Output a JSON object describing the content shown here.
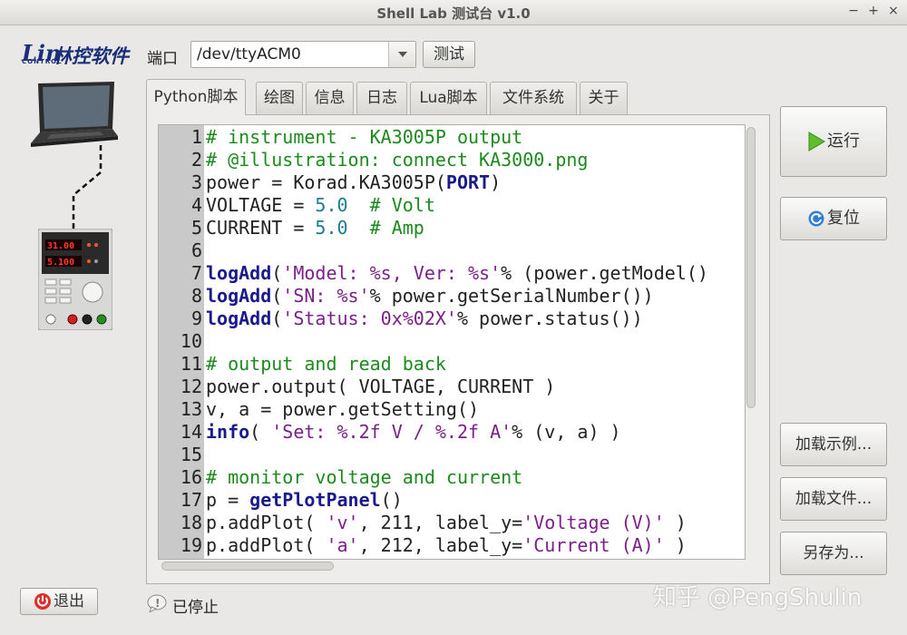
{
  "window": {
    "title": "Shell Lab 测试台 v1.0",
    "controls": [
      "−",
      "+",
      "×"
    ]
  },
  "logo": {
    "mark": "Lin",
    "sub": "CONTROL",
    "brand": "林控软件"
  },
  "port": {
    "label": "端口",
    "value": "/dev/ttyACM0",
    "test_label": "测试"
  },
  "psu_display": {
    "voltage": "31.00",
    "current": "5.100"
  },
  "tabs": [
    {
      "label": "Python脚本",
      "active": true
    },
    {
      "label": "绘图"
    },
    {
      "label": "信息"
    },
    {
      "label": "日志"
    },
    {
      "label": "Lua脚本"
    },
    {
      "label": "文件系统"
    },
    {
      "label": "关于"
    }
  ],
  "editor": {
    "lines": [
      {
        "n": "1",
        "t": [
          [
            "com",
            "# instrument - KA3005P output"
          ]
        ]
      },
      {
        "n": "2",
        "t": [
          [
            "com",
            "# @illustration: connect KA3000.png"
          ]
        ]
      },
      {
        "n": "3",
        "t": [
          [
            "",
            "power = Korad.KA3005P("
          ],
          [
            "kw",
            "PORT"
          ],
          [
            "",
            ")"
          ]
        ]
      },
      {
        "n": "4",
        "t": [
          [
            "",
            "VOLTAGE = "
          ],
          [
            "num",
            "5.0"
          ],
          [
            "",
            "  "
          ],
          [
            "com",
            "# Volt"
          ]
        ]
      },
      {
        "n": "5",
        "t": [
          [
            "",
            "CURRENT = "
          ],
          [
            "num",
            "5.0"
          ],
          [
            "",
            "  "
          ],
          [
            "com",
            "# Amp"
          ]
        ]
      },
      {
        "n": "6",
        "t": []
      },
      {
        "n": "7",
        "t": [
          [
            "kw",
            "logAdd"
          ],
          [
            "",
            "("
          ],
          [
            "str",
            "'Model: %s, Ver: %s'"
          ],
          [
            "",
            "% (power.getModel()"
          ]
        ]
      },
      {
        "n": "8",
        "t": [
          [
            "kw",
            "logAdd"
          ],
          [
            "",
            "("
          ],
          [
            "str",
            "'SN: %s'"
          ],
          [
            "",
            "% power.getSerialNumber())"
          ]
        ]
      },
      {
        "n": "9",
        "t": [
          [
            "kw",
            "logAdd"
          ],
          [
            "",
            "("
          ],
          [
            "str",
            "'Status: 0x%02X'"
          ],
          [
            "",
            "% power.status())"
          ]
        ]
      },
      {
        "n": "10",
        "t": []
      },
      {
        "n": "11",
        "t": [
          [
            "com",
            "# output and read back"
          ]
        ]
      },
      {
        "n": "12",
        "t": [
          [
            "",
            "power.output( VOLTAGE, CURRENT )"
          ]
        ]
      },
      {
        "n": "13",
        "t": [
          [
            "",
            "v, a = power.getSetting()"
          ]
        ]
      },
      {
        "n": "14",
        "t": [
          [
            "kw",
            "info"
          ],
          [
            "",
            "( "
          ],
          [
            "str",
            "'Set: %.2f V / %.2f A'"
          ],
          [
            "",
            "% (v, a) )"
          ]
        ]
      },
      {
        "n": "15",
        "t": []
      },
      {
        "n": "16",
        "t": [
          [
            "com",
            "# monitor voltage and current"
          ]
        ]
      },
      {
        "n": "17",
        "t": [
          [
            "",
            "p = "
          ],
          [
            "kw",
            "getPlotPanel"
          ],
          [
            "",
            "()"
          ]
        ]
      },
      {
        "n": "18",
        "t": [
          [
            "",
            "p.addPlot( "
          ],
          [
            "str",
            "'v'"
          ],
          [
            "",
            ", 211, label_y="
          ],
          [
            "str",
            "'Voltage (V)'"
          ],
          [
            "",
            " )"
          ]
        ]
      },
      {
        "n": "19",
        "t": [
          [
            "",
            "p.addPlot( "
          ],
          [
            "str",
            "'a'"
          ],
          [
            "",
            ", 212, label_y="
          ],
          [
            "str",
            "'Current (A)'"
          ],
          [
            "",
            " )"
          ]
        ]
      }
    ]
  },
  "buttons": {
    "run": "运行",
    "reset": "复位",
    "load_example": "加载示例...",
    "load_file": "加载文件...",
    "save_as": "另存为...",
    "exit": "退出"
  },
  "status": {
    "text": "已停止"
  },
  "watermark": "知乎 @PengShulin",
  "colors": {
    "comment": "#1d8a1d",
    "string": "#7a2088",
    "number": "#1c7d8c",
    "keyword": "#1a1a8c",
    "run_icon": "#5fbf2a",
    "exit_icon": "#d9302c"
  }
}
